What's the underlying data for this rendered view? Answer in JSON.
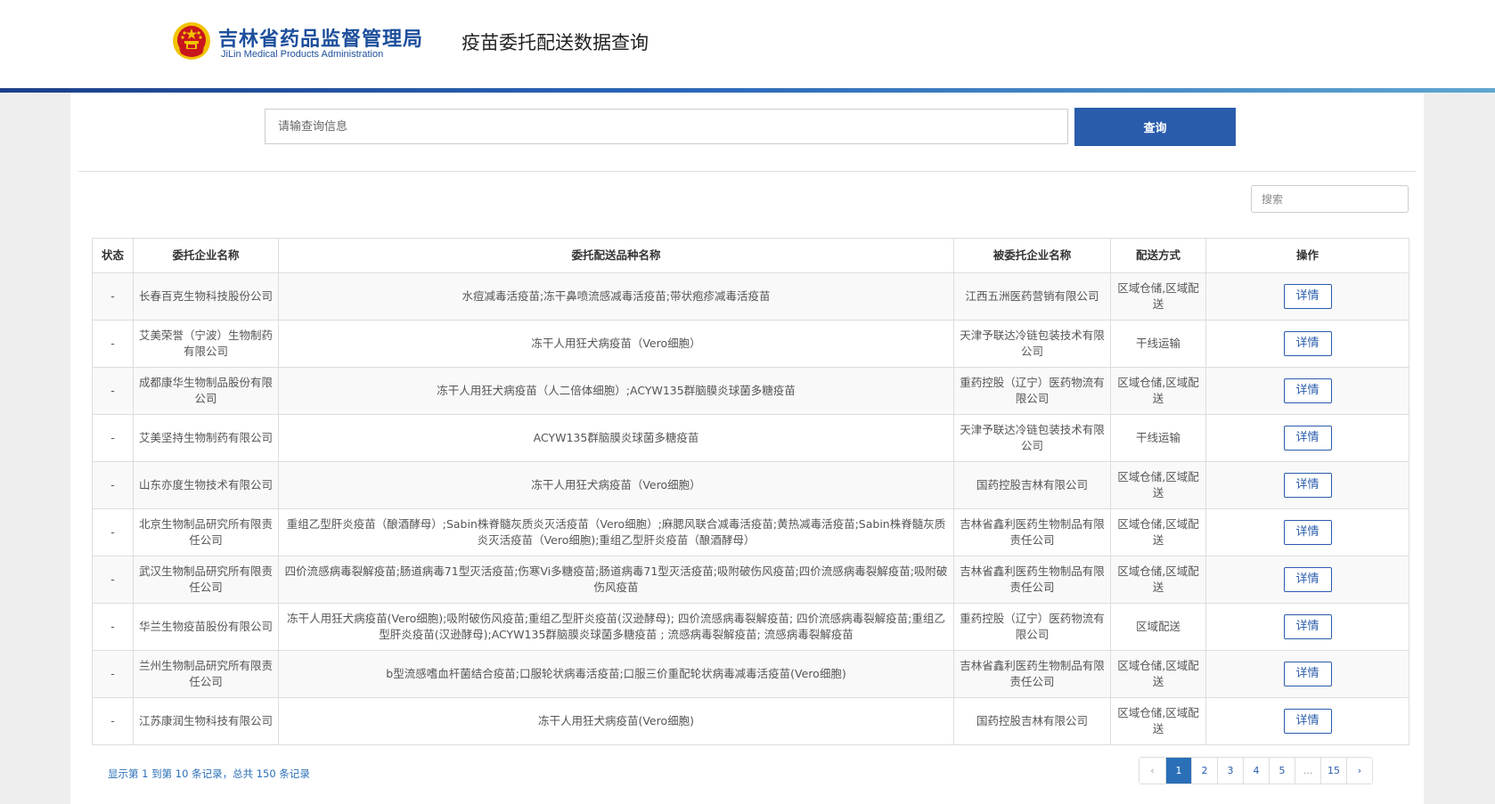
{
  "header": {
    "org_name_cn": "吉林省药品监督管理局",
    "org_name_en": "JiLin Medical Products Administration",
    "page_title": "疫苗委托配送数据查询",
    "emblem_icon": "national-emblem-icon"
  },
  "query": {
    "placeholder": "请输查询信息",
    "button_label": "查询"
  },
  "search": {
    "placeholder": "搜索"
  },
  "table": {
    "columns": [
      "状态",
      "委托企业名称",
      "委托配送品种名称",
      "被委托企业名称",
      "配送方式",
      "操作"
    ],
    "rows": [
      {
        "status": "-",
        "client": "长春百克生物科技股份公司",
        "vaccines": "水痘减毒活疫苗;冻干鼻喷流感减毒活疫苗;带状疱疹减毒活疫苗",
        "agent": "江西五洲医药营销有限公司",
        "method": "区域仓储,区域配送",
        "action": "详情"
      },
      {
        "status": "-",
        "client": "艾美荣誉（宁波）生物制药有限公司",
        "vaccines": "冻干人用狂犬病疫苗（Vero细胞）",
        "agent": "天津予联达冷链包装技术有限公司",
        "method": "干线运输",
        "action": "详情"
      },
      {
        "status": "-",
        "client": "成都康华生物制品股份有限公司",
        "vaccines": "冻干人用狂犬病疫苗（人二倍体细胞）;ACYW135群脑膜炎球菌多糖疫苗",
        "agent": "重药控股（辽宁）医药物流有限公司",
        "method": "区域仓储,区域配送",
        "action": "详情"
      },
      {
        "status": "-",
        "client": "艾美坚持生物制药有限公司",
        "vaccines": "ACYW135群脑膜炎球菌多糖疫苗",
        "agent": "天津予联达冷链包装技术有限公司",
        "method": "干线运输",
        "action": "详情"
      },
      {
        "status": "-",
        "client": "山东亦度生物技术有限公司",
        "vaccines": "冻干人用狂犬病疫苗（Vero细胞）",
        "agent": "国药控股吉林有限公司",
        "method": "区域仓储,区域配送",
        "action": "详情"
      },
      {
        "status": "-",
        "client": "北京生物制品研究所有限责任公司",
        "vaccines": "重组乙型肝炎疫苗（酿酒酵母）;Sabin株脊髓灰质炎灭活疫苗（Vero细胞）;麻腮风联合减毒活疫苗;黄热减毒活疫苗;Sabin株脊髓灰质炎灭活疫苗（Vero细胞);重组乙型肝炎疫苗（酿酒酵母）",
        "agent": "吉林省鑫利医药生物制品有限责任公司",
        "method": "区域仓储,区域配送",
        "action": "详情"
      },
      {
        "status": "-",
        "client": "武汉生物制品研究所有限责任公司",
        "vaccines": "四价流感病毒裂解疫苗;肠道病毒71型灭活疫苗;伤寒Vi多糖疫苗;肠道病毒71型灭活疫苗;吸附破伤风疫苗;四价流感病毒裂解疫苗;吸附破伤风疫苗",
        "agent": "吉林省鑫利医药生物制品有限责任公司",
        "method": "区域仓储,区域配送",
        "action": "详情"
      },
      {
        "status": "-",
        "client": "华兰生物疫苗股份有限公司",
        "vaccines": "冻干人用狂犬病疫苗(Vero细胞);吸附破伤风疫苗;重组乙型肝炎疫苗(汉逊酵母); 四价流感病毒裂解疫苗; 四价流感病毒裂解疫苗;重组乙型肝炎疫苗(汉逊酵母);ACYW135群脑膜炎球菌多糖疫苗 ; 流感病毒裂解疫苗; 流感病毒裂解疫苗",
        "agent": "重药控股（辽宁）医药物流有限公司",
        "method": "区域配送",
        "action": "详情"
      },
      {
        "status": "-",
        "client": "兰州生物制品研究所有限责任公司",
        "vaccines": "b型流感嗜血杆菌结合疫苗;口服轮状病毒活疫苗;口服三价重配轮状病毒减毒活疫苗(Vero细胞)",
        "agent": "吉林省鑫利医药生物制品有限责任公司",
        "method": "区域仓储,区域配送",
        "action": "详情"
      },
      {
        "status": "-",
        "client": "江苏康润生物科技有限公司",
        "vaccines": "冻干人用狂犬病疫苗(Vero细胞)",
        "agent": "国药控股吉林有限公司",
        "method": "区域仓储,区域配送",
        "action": "详情"
      }
    ]
  },
  "pager": {
    "info": "显示第 1 到第 10 条记录，总共 150 条记录",
    "prev": "‹",
    "pages": [
      "1",
      "2",
      "3",
      "4",
      "5",
      "...",
      "15"
    ],
    "next": "›",
    "active_page": "1"
  },
  "colors": {
    "brand_blue": "#1d4f9c",
    "button_blue": "#2a5cac",
    "link_blue": "#2a6fb8",
    "emblem_red": "#c8161d",
    "emblem_gold": "#f2c300"
  }
}
